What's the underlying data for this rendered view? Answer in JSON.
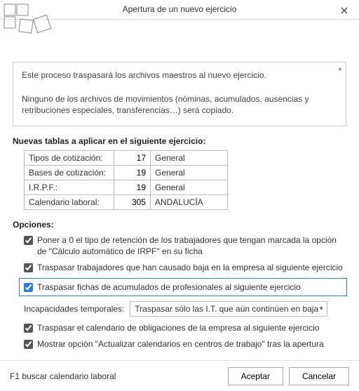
{
  "window": {
    "title": "Apertura de un nuevo ejercicio"
  },
  "info": {
    "line1": "Este proceso traspasará los archivos maestros al nuevo ejercicio.",
    "line2": "Ninguno de los archivos de movimientos (nóminas, acumulados, ausencias y retribuciones especiales, transferencias…) será copiado."
  },
  "tables_section_title": "Nuevas tablas a aplicar en el siguiente ejercicio:",
  "tables": {
    "rows": [
      {
        "label": "Tipos de cotización:",
        "code": "17",
        "desc": "General"
      },
      {
        "label": "Bases de cotización:",
        "code": "19",
        "desc": "General"
      },
      {
        "label": "I.R.P.F.:",
        "code": "19",
        "desc": "General"
      },
      {
        "label": "Calendario laboral:",
        "code": "305",
        "desc": "ANDALUCÍA"
      }
    ]
  },
  "options_section_title": "Opciones:",
  "options": {
    "reset_irpf": "Poner a 0 el tipo de retención de los trabajadores que tengan marcada la opción de \"Cálculo automático de IRPF\" en su ficha",
    "transfer_baja": "Traspasar trabajadores que han causado baja en la empresa al siguiente ejercicio",
    "transfer_acumulados": "Traspasar fichas de acumulados de profesionales al siguiente ejercicio",
    "incap_label": "Incapacidades temporales:",
    "incap_selected": "Traspasar sólo las I.T. que aún continúen en baja",
    "transfer_calendar": "Traspasar el calendario de obligaciones de la empresa al siguiente ejercicio",
    "show_update": "Mostrar opción \"Actualizar calendarios en centros de trabajo\" tras la apertura"
  },
  "footer": {
    "status": "F1 buscar calendario laboral",
    "ok": "Aceptar",
    "cancel": "Cancelar"
  }
}
